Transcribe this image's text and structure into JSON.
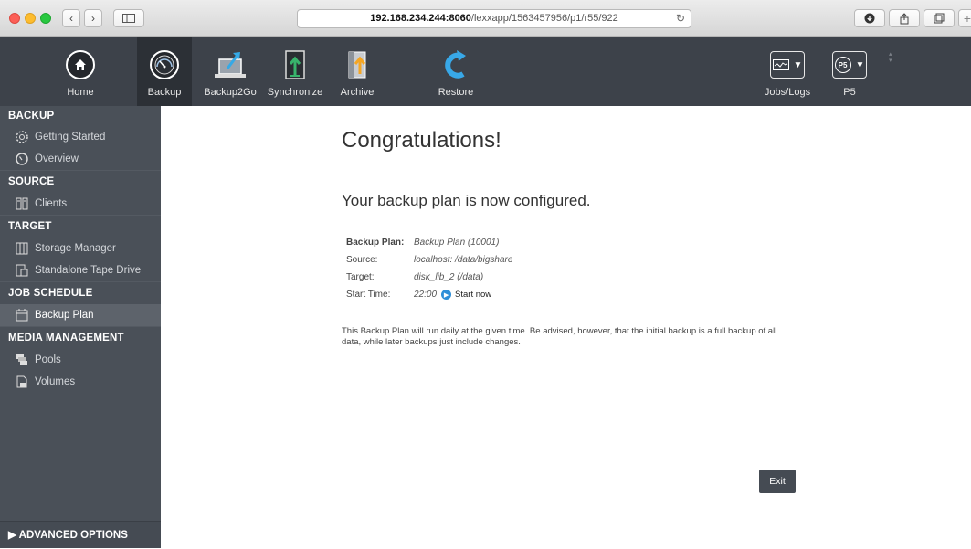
{
  "browser": {
    "url_host": "192.168.234.244:8060",
    "url_path": "/lexxapp/1563457956/p1/r55/922"
  },
  "toolbar": {
    "items": [
      {
        "label": "Home"
      },
      {
        "label": "Backup"
      },
      {
        "label": "Backup2Go"
      },
      {
        "label": "Synchronize"
      },
      {
        "label": "Archive"
      },
      {
        "label": "Restore"
      }
    ],
    "jobs_logs_label": "Jobs/Logs",
    "p5_label": "P5",
    "p5_badge": "P5"
  },
  "sidebar": {
    "sections": [
      {
        "title": "BACKUP",
        "items": [
          {
            "label": "Getting Started"
          },
          {
            "label": "Overview"
          }
        ]
      },
      {
        "title": "SOURCE",
        "items": [
          {
            "label": "Clients"
          }
        ]
      },
      {
        "title": "TARGET",
        "items": [
          {
            "label": "Storage Manager"
          },
          {
            "label": "Standalone Tape Drive"
          }
        ]
      },
      {
        "title": "JOB SCHEDULE",
        "items": [
          {
            "label": "Backup Plan"
          }
        ]
      },
      {
        "title": "MEDIA MANAGEMENT",
        "items": [
          {
            "label": "Pools"
          },
          {
            "label": "Volumes"
          }
        ]
      }
    ],
    "advanced_label": "ADVANCED OPTIONS"
  },
  "main": {
    "title": "Congratulations!",
    "subtitle": "Your backup plan is now configured.",
    "details": {
      "backup_plan_label": "Backup Plan:",
      "backup_plan_value": "Backup Plan (10001)",
      "source_label": "Source:",
      "source_value": "localhost: /data/bigshare",
      "target_label": "Target:",
      "target_value": "disk_lib_2 (/data)",
      "start_time_label": "Start Time:",
      "start_time_value": "22:00",
      "start_now_label": "Start now"
    },
    "note": "This Backup Plan will run daily at the given time. Be advised, however, that the initial backup is a full backup of all data, while later backups just include changes.",
    "exit_label": "Exit"
  },
  "colors": {
    "toolbar_bg": "#3d424a",
    "sidebar_bg": "#4a5058",
    "active_item_bg": "#5d636b",
    "accent_blue": "#2f8fd8"
  },
  "icons": {
    "home": "home-icon",
    "backup": "speedometer-icon",
    "backup2go": "laptop-upload-icon",
    "synchronize": "sync-door-icon",
    "archive": "archive-arrow-icon",
    "restore": "restore-arrow-icon",
    "jobs_logs": "activity-chart-icon",
    "p5": "p5-logo-icon"
  }
}
